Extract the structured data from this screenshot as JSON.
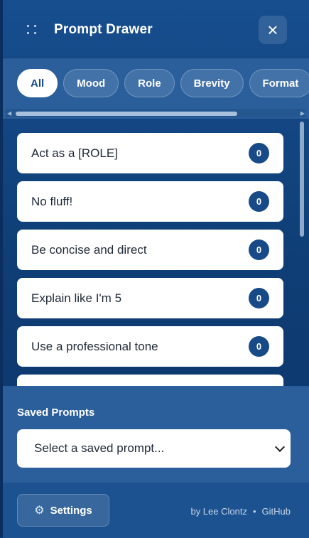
{
  "header": {
    "title": "Prompt Drawer",
    "close_label": "×"
  },
  "tabs": [
    {
      "label": "All",
      "active": true
    },
    {
      "label": "Mood",
      "active": false
    },
    {
      "label": "Role",
      "active": false
    },
    {
      "label": "Brevity",
      "active": false
    },
    {
      "label": "Format",
      "active": false
    }
  ],
  "prompts": [
    {
      "label": "Act as a [ROLE]",
      "count": "0"
    },
    {
      "label": "No fluff!",
      "count": "0"
    },
    {
      "label": "Be concise and direct",
      "count": "0"
    },
    {
      "label": "Explain like I'm 5",
      "count": "0"
    },
    {
      "label": "Use a professional tone",
      "count": "0"
    },
    {
      "label": "",
      "count": ""
    }
  ],
  "saved": {
    "label": "Saved Prompts",
    "placeholder": "Select a saved prompt..."
  },
  "footer": {
    "settings_label": "Settings",
    "author": "by Lee Clontz",
    "separator": "•",
    "link": "GitHub"
  },
  "colors": {
    "primary": "#174a86",
    "panel": "#2a5f9c",
    "accent_white": "#ffffff"
  }
}
